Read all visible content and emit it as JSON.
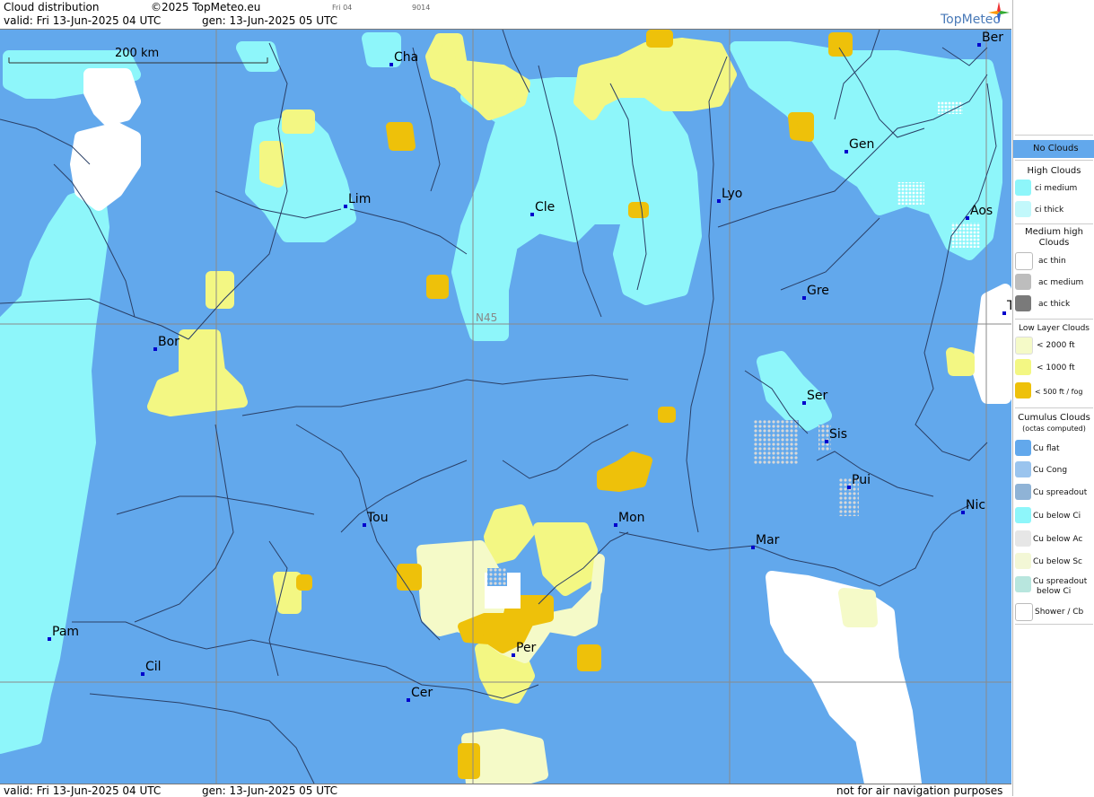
{
  "header": {
    "title": "Cloud distribution",
    "copyright": "©2025 TopMeteo.eu",
    "valid": "valid:  Fri  13-Jun-2025  04 UTC",
    "gen": "gen: 13-Jun-2025 05 UTC",
    "small_day": "Fri 04",
    "small_code": "9014",
    "brand": "TopMeteo"
  },
  "map": {
    "scale_label": "200 km",
    "grid_label": "N45",
    "colors": {
      "no_clouds": "#62a8ec",
      "ci_medium": "#8ef6fa",
      "ci_thick": "#c2f8fb",
      "ac_thin": "#ffffff",
      "low_2000": "#f5fac8",
      "low_1000": "#f3f783",
      "low_500": "#eec10a",
      "cu_below_ac": "#cfcfcf"
    },
    "cities": [
      {
        "name": "Cha"
      },
      {
        "name": "Ber"
      },
      {
        "name": "Lim"
      },
      {
        "name": "Cle"
      },
      {
        "name": "Lyo"
      },
      {
        "name": "Gen"
      },
      {
        "name": "Aos"
      },
      {
        "name": "Gre"
      },
      {
        "name": "Bor"
      },
      {
        "name": "Ser"
      },
      {
        "name": "Sis"
      },
      {
        "name": "Pui"
      },
      {
        "name": "Tou"
      },
      {
        "name": "Mon"
      },
      {
        "name": "Nic"
      },
      {
        "name": "Mar"
      },
      {
        "name": "Pam"
      },
      {
        "name": "Cil"
      },
      {
        "name": "Per"
      },
      {
        "name": "Cer"
      },
      {
        "name": "T"
      }
    ]
  },
  "footer": {
    "valid": "valid:  Fri  13-Jun-2025  04 UTC",
    "gen": "gen: 13-Jun-2025 05 UTC",
    "disclaimer": "not for air navigation purposes"
  },
  "legend": {
    "no_clouds": "No Clouds",
    "high_head": "High Clouds",
    "ci_medium": "ci medium",
    "ci_thick": "ci thick",
    "medium_head_1": "Medium high",
    "medium_head_2": "Clouds",
    "ac_thin": "ac thin",
    "ac_medium": "ac medium",
    "ac_thick": "ac thick",
    "low_head": "Low Layer Clouds",
    "low_2000": "< 2000 ft",
    "low_1000": "< 1000 ft",
    "low_500": "< 500 ft / fog",
    "cu_head_1": "Cumulus Clouds",
    "cu_head_2": "(octas computed)",
    "cu_flat": "Cu flat",
    "cu_cong": "Cu Cong",
    "cu_spread": "Cu spreadout",
    "cu_below_ci": "Cu below Ci",
    "cu_below_ac": "Cu below Ac",
    "cu_below_sc": "Cu below Sc",
    "cu_spread_ci_1": "Cu spreadout",
    "cu_spread_ci_2": "below Ci",
    "shower": "Shower / Cb"
  }
}
